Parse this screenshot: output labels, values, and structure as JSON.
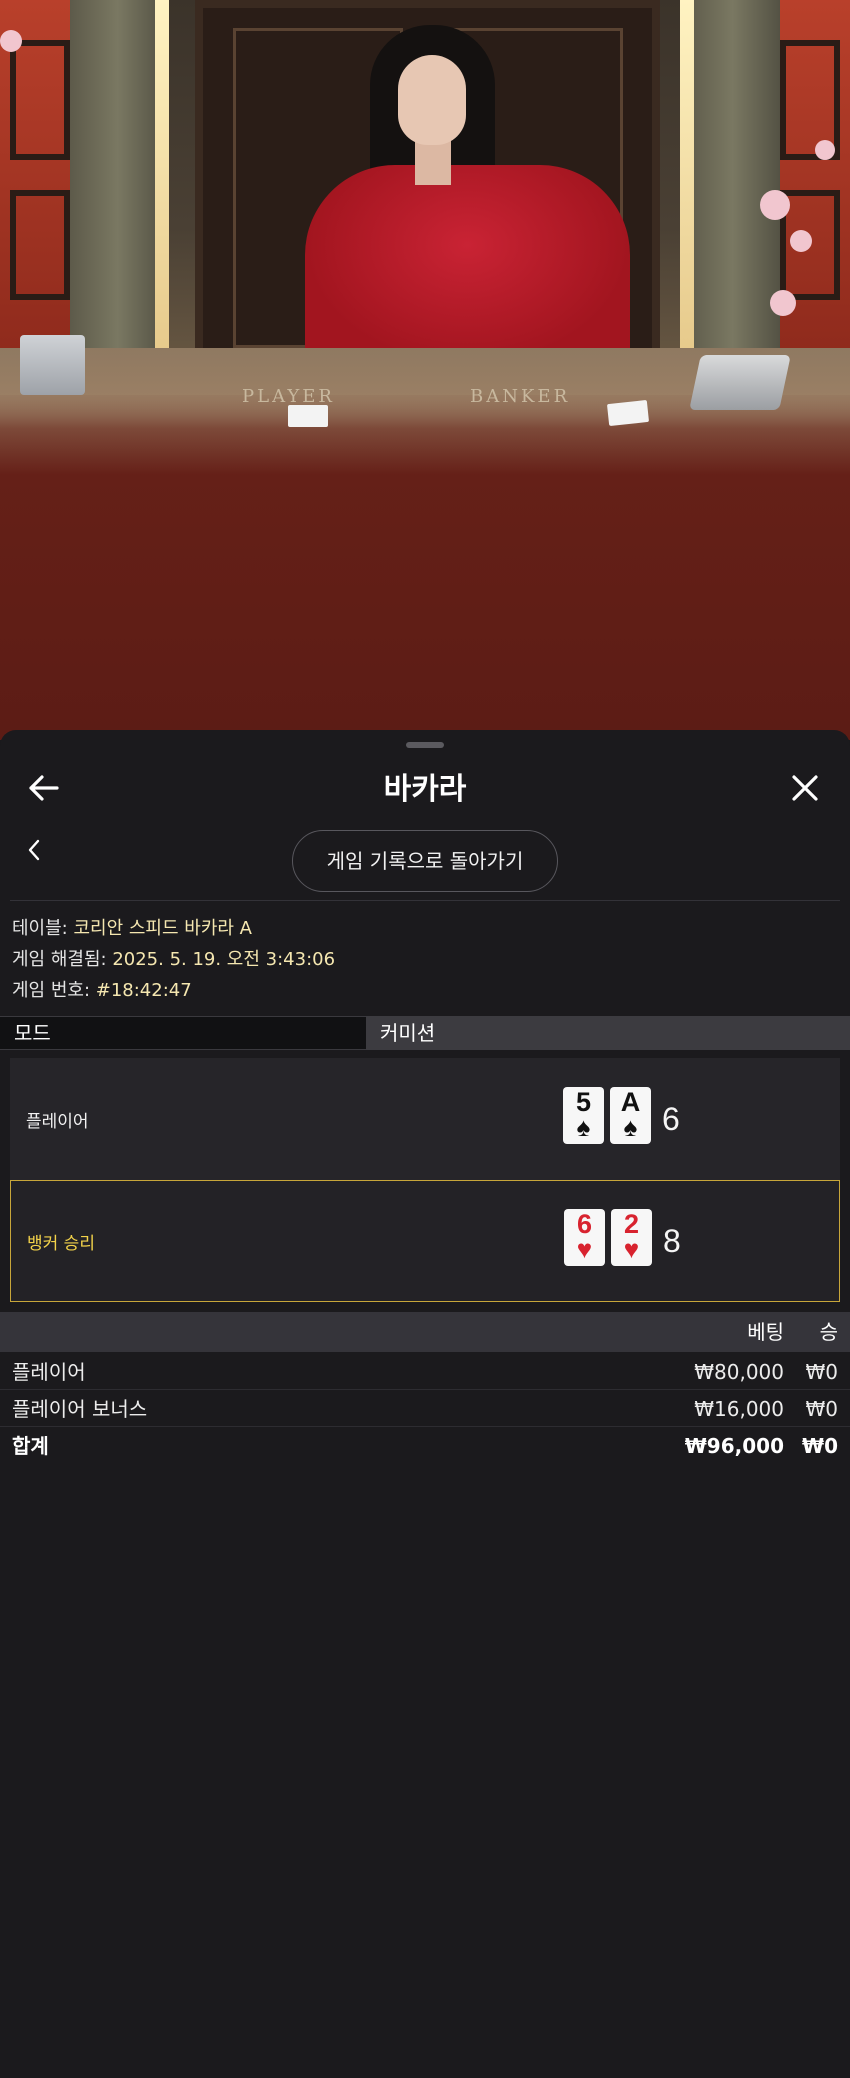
{
  "video": {
    "felt_player": "PLAYER",
    "felt_banker": "BANKER"
  },
  "sheet": {
    "back_icon": "arrow-left-icon",
    "title": "바카라",
    "close_icon": "close-x-icon",
    "prev_icon": "chevron-left-icon",
    "back_to_history_label": "게임 기록으로 돌아가기"
  },
  "info": {
    "table_label": "테이블: ",
    "table_value": "코리안 스피드 바카라 A",
    "resolved_label": "게임 해결됨: ",
    "resolved_value": "2025. 5. 19. 오전 3:43:06",
    "game_no_label": "게임 번호: ",
    "game_no_value": "#18:42:47"
  },
  "mode": {
    "label": "모드",
    "value": "커미션"
  },
  "results": [
    {
      "name": "플레이어",
      "cards": [
        {
          "rank": "5",
          "suit": "♠",
          "color": "black"
        },
        {
          "rank": "A",
          "suit": "♠",
          "color": "black"
        }
      ],
      "score": "6",
      "winner": false
    },
    {
      "name": "뱅커 승리",
      "cards": [
        {
          "rank": "6",
          "suit": "♥",
          "color": "red"
        },
        {
          "rank": "2",
          "suit": "♥",
          "color": "red"
        }
      ],
      "score": "8",
      "winner": true
    }
  ],
  "bets": {
    "col_bet": "베팅",
    "col_win": "승",
    "rows": [
      {
        "name": "플레이어",
        "bet": "₩80,000",
        "win": "₩0"
      },
      {
        "name": "플레이어 보너스",
        "bet": "₩16,000",
        "win": "₩0"
      }
    ],
    "total": {
      "name": "합계",
      "bet": "₩96,000",
      "win": "₩0"
    }
  },
  "colors": {
    "winner_accent": "#c7a63a",
    "sheet_bg": "#1b1a1d",
    "info_value": "#f5e7b0"
  }
}
